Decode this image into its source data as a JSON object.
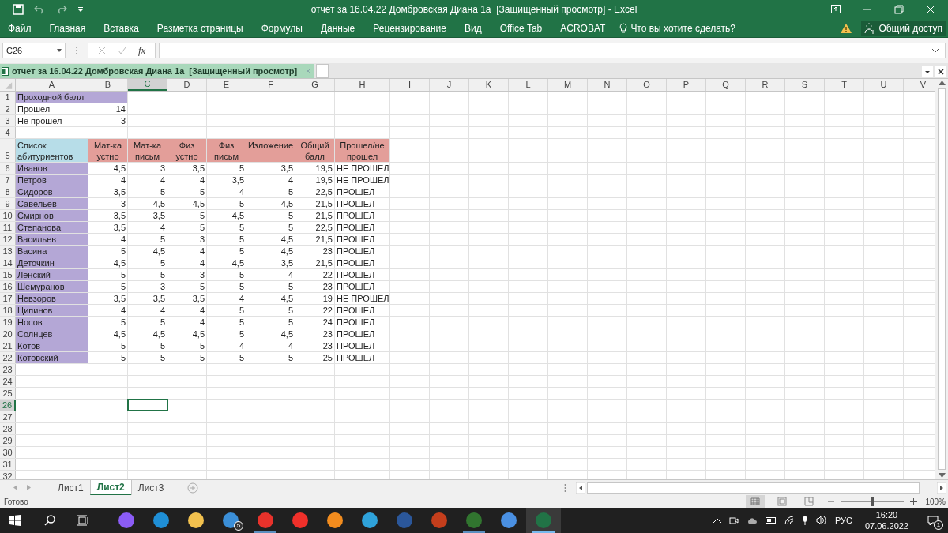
{
  "window": {
    "title": "отчет за 16.04.22 Домбровская Диана 1а  [Защищенный просмотр] - Excel"
  },
  "ribbon": {
    "tabs": [
      {
        "label": "Файл"
      },
      {
        "label": "Главная"
      },
      {
        "label": "Вставка"
      },
      {
        "label": "Разметка страницы"
      },
      {
        "label": "Формулы"
      },
      {
        "label": "Данные"
      },
      {
        "label": "Рецензирование"
      },
      {
        "label": "Вид"
      },
      {
        "label": "Office Tab"
      },
      {
        "label": "ACROBAT"
      }
    ],
    "tell_me": "Что вы хотите сделать?",
    "share": "Общий доступ"
  },
  "formula_bar": {
    "name_box": "C26",
    "function_label": "fx"
  },
  "document_tab": {
    "title": "отчет за 16.04.22 Домбровская Диана 1а  [Защищенный просмотр]"
  },
  "sheet": {
    "columns": [
      {
        "label": "A",
        "selected": false
      },
      {
        "label": "B",
        "selected": false
      },
      {
        "label": "C",
        "selected": true
      },
      {
        "label": "D",
        "selected": false
      },
      {
        "label": "E",
        "selected": false
      },
      {
        "label": "F",
        "selected": false
      },
      {
        "label": "G",
        "selected": false
      },
      {
        "label": "H",
        "selected": false
      },
      {
        "label": "I",
        "selected": false
      },
      {
        "label": "J",
        "selected": false
      },
      {
        "label": "K",
        "selected": false
      },
      {
        "label": "L",
        "selected": false
      },
      {
        "label": "M",
        "selected": false
      },
      {
        "label": "N",
        "selected": false
      },
      {
        "label": "O",
        "selected": false
      },
      {
        "label": "P",
        "selected": false
      },
      {
        "label": "Q",
        "selected": false
      },
      {
        "label": "R",
        "selected": false
      },
      {
        "label": "S",
        "selected": false
      },
      {
        "label": "T",
        "selected": false
      },
      {
        "label": "U",
        "selected": false
      },
      {
        "label": "V",
        "selected": false
      }
    ],
    "rows": [
      {
        "number": "1",
        "selected": false,
        "cells": [
          {
            "text": "Проходной балл",
            "kind": "name"
          },
          {
            "kind": "name"
          }
        ]
      },
      {
        "number": "2",
        "selected": false,
        "cells": [
          {
            "text": "Прошел",
            "kind": "label"
          },
          {
            "text": "14",
            "kind": "number"
          }
        ]
      },
      {
        "number": "3",
        "selected": false,
        "cells": [
          {
            "text": "Не прошел",
            "kind": "label"
          },
          {
            "text": "3",
            "kind": "number"
          }
        ]
      },
      {
        "number": "4",
        "selected": false
      },
      {
        "number": "5",
        "selected": false,
        "cells": [
          {
            "text": "Список абитуриентов",
            "kind": "list_head"
          },
          {
            "text": "Мат-ка устно",
            "kind": "col_head"
          },
          {
            "text": "Мат-ка письм",
            "kind": "col_head"
          },
          {
            "text": "Физ устно",
            "kind": "col_head"
          },
          {
            "text": "Физ письм",
            "kind": "col_head"
          },
          {
            "text": "Изложение",
            "kind": "col_head"
          },
          {
            "text": "Общий балл",
            "kind": "col_head"
          },
          {
            "text": "Прошел/не прошел",
            "kind": "col_head"
          }
        ]
      },
      {
        "number": "6",
        "selected": false,
        "cells": [
          {
            "text": "Иванов",
            "kind": "name"
          },
          {
            "text": "4,5",
            "kind": "number"
          },
          {
            "text": "3",
            "kind": "number"
          },
          {
            "text": "3,5",
            "kind": "number"
          },
          {
            "text": "5",
            "kind": "number"
          },
          {
            "text": "3,5",
            "kind": "number"
          },
          {
            "text": "19,5",
            "kind": "number"
          },
          {
            "text": "НЕ ПРОШЕЛ",
            "kind": "label"
          }
        ]
      },
      {
        "number": "7",
        "selected": false,
        "cells": [
          {
            "text": "Петров",
            "kind": "name"
          },
          {
            "text": "4",
            "kind": "number"
          },
          {
            "text": "4",
            "kind": "number"
          },
          {
            "text": "4",
            "kind": "number"
          },
          {
            "text": "3,5",
            "kind": "number"
          },
          {
            "text": "4",
            "kind": "number"
          },
          {
            "text": "19,5",
            "kind": "number"
          },
          {
            "text": "НЕ ПРОШЕЛ",
            "kind": "label"
          }
        ]
      },
      {
        "number": "8",
        "selected": false,
        "cells": [
          {
            "text": "Сидоров",
            "kind": "name"
          },
          {
            "text": "3,5",
            "kind": "number"
          },
          {
            "text": "5",
            "kind": "number"
          },
          {
            "text": "5",
            "kind": "number"
          },
          {
            "text": "4",
            "kind": "number"
          },
          {
            "text": "5",
            "kind": "number"
          },
          {
            "text": "22,5",
            "kind": "number"
          },
          {
            "text": "ПРОШЕЛ",
            "kind": "label"
          }
        ]
      },
      {
        "number": "9",
        "selected": false,
        "cells": [
          {
            "text": "Савельев",
            "kind": "name"
          },
          {
            "text": "3",
            "kind": "number"
          },
          {
            "text": "4,5",
            "kind": "number"
          },
          {
            "text": "4,5",
            "kind": "number"
          },
          {
            "text": "5",
            "kind": "number"
          },
          {
            "text": "4,5",
            "kind": "number"
          },
          {
            "text": "21,5",
            "kind": "number"
          },
          {
            "text": "ПРОШЕЛ",
            "kind": "label"
          }
        ]
      },
      {
        "number": "10",
        "selected": false,
        "cells": [
          {
            "text": "Смирнов",
            "kind": "name"
          },
          {
            "text": "3,5",
            "kind": "number"
          },
          {
            "text": "3,5",
            "kind": "number"
          },
          {
            "text": "5",
            "kind": "number"
          },
          {
            "text": "4,5",
            "kind": "number"
          },
          {
            "text": "5",
            "kind": "number"
          },
          {
            "text": "21,5",
            "kind": "number"
          },
          {
            "text": "ПРОШЕЛ",
            "kind": "label"
          }
        ]
      },
      {
        "number": "11",
        "selected": false,
        "cells": [
          {
            "text": "Степанова",
            "kind": "name"
          },
          {
            "text": "3,5",
            "kind": "number"
          },
          {
            "text": "4",
            "kind": "number"
          },
          {
            "text": "5",
            "kind": "number"
          },
          {
            "text": "5",
            "kind": "number"
          },
          {
            "text": "5",
            "kind": "number"
          },
          {
            "text": "22,5",
            "kind": "number"
          },
          {
            "text": "ПРОШЕЛ",
            "kind": "label"
          }
        ]
      },
      {
        "number": "12",
        "selected": false,
        "cells": [
          {
            "text": "Васильев",
            "kind": "name"
          },
          {
            "text": "4",
            "kind": "number"
          },
          {
            "text": "5",
            "kind": "number"
          },
          {
            "text": "3",
            "kind": "number"
          },
          {
            "text": "5",
            "kind": "number"
          },
          {
            "text": "4,5",
            "kind": "number"
          },
          {
            "text": "21,5",
            "kind": "number"
          },
          {
            "text": "ПРОШЕЛ",
            "kind": "label"
          }
        ]
      },
      {
        "number": "13",
        "selected": false,
        "cells": [
          {
            "text": "Васина",
            "kind": "name"
          },
          {
            "text": "5",
            "kind": "number"
          },
          {
            "text": "4,5",
            "kind": "number"
          },
          {
            "text": "4",
            "kind": "number"
          },
          {
            "text": "5",
            "kind": "number"
          },
          {
            "text": "4,5",
            "kind": "number"
          },
          {
            "text": "23",
            "kind": "number"
          },
          {
            "text": "ПРОШЕЛ",
            "kind": "label"
          }
        ]
      },
      {
        "number": "14",
        "selected": false,
        "cells": [
          {
            "text": "Деточкин",
            "kind": "name"
          },
          {
            "text": "4,5",
            "kind": "number"
          },
          {
            "text": "5",
            "kind": "number"
          },
          {
            "text": "4",
            "kind": "number"
          },
          {
            "text": "4,5",
            "kind": "number"
          },
          {
            "text": "3,5",
            "kind": "number"
          },
          {
            "text": "21,5",
            "kind": "number"
          },
          {
            "text": "ПРОШЕЛ",
            "kind": "label"
          }
        ]
      },
      {
        "number": "15",
        "selected": false,
        "cells": [
          {
            "text": "Ленский",
            "kind": "name"
          },
          {
            "text": "5",
            "kind": "number"
          },
          {
            "text": "5",
            "kind": "number"
          },
          {
            "text": "3",
            "kind": "number"
          },
          {
            "text": "5",
            "kind": "number"
          },
          {
            "text": "4",
            "kind": "number"
          },
          {
            "text": "22",
            "kind": "number"
          },
          {
            "text": "ПРОШЕЛ",
            "kind": "label"
          }
        ]
      },
      {
        "number": "16",
        "selected": false,
        "cells": [
          {
            "text": "Шемуранов",
            "kind": "name"
          },
          {
            "text": "5",
            "kind": "number"
          },
          {
            "text": "3",
            "kind": "number"
          },
          {
            "text": "5",
            "kind": "number"
          },
          {
            "text": "5",
            "kind": "number"
          },
          {
            "text": "5",
            "kind": "number"
          },
          {
            "text": "23",
            "kind": "number"
          },
          {
            "text": "ПРОШЕЛ",
            "kind": "label"
          }
        ]
      },
      {
        "number": "17",
        "selected": false,
        "cells": [
          {
            "text": "Невзоров",
            "kind": "name"
          },
          {
            "text": "3,5",
            "kind": "number"
          },
          {
            "text": "3,5",
            "kind": "number"
          },
          {
            "text": "3,5",
            "kind": "number"
          },
          {
            "text": "4",
            "kind": "number"
          },
          {
            "text": "4,5",
            "kind": "number"
          },
          {
            "text": "19",
            "kind": "number"
          },
          {
            "text": "НЕ ПРОШЕЛ",
            "kind": "label"
          }
        ]
      },
      {
        "number": "18",
        "selected": false,
        "cells": [
          {
            "text": "Ципинов",
            "kind": "name"
          },
          {
            "text": "4",
            "kind": "number"
          },
          {
            "text": "4",
            "kind": "number"
          },
          {
            "text": "4",
            "kind": "number"
          },
          {
            "text": "5",
            "kind": "number"
          },
          {
            "text": "5",
            "kind": "number"
          },
          {
            "text": "22",
            "kind": "number"
          },
          {
            "text": "ПРОШЕЛ",
            "kind": "label"
          }
        ]
      },
      {
        "number": "19",
        "selected": false,
        "cells": [
          {
            "text": "Носов",
            "kind": "name"
          },
          {
            "text": "5",
            "kind": "number"
          },
          {
            "text": "5",
            "kind": "number"
          },
          {
            "text": "4",
            "kind": "number"
          },
          {
            "text": "5",
            "kind": "number"
          },
          {
            "text": "5",
            "kind": "number"
          },
          {
            "text": "24",
            "kind": "number"
          },
          {
            "text": "ПРОШЕЛ",
            "kind": "label"
          }
        ]
      },
      {
        "number": "20",
        "selected": false,
        "cells": [
          {
            "text": "Солнцев",
            "kind": "name"
          },
          {
            "text": "4,5",
            "kind": "number"
          },
          {
            "text": "4,5",
            "kind": "number"
          },
          {
            "text": "4,5",
            "kind": "number"
          },
          {
            "text": "5",
            "kind": "number"
          },
          {
            "text": "4,5",
            "kind": "number"
          },
          {
            "text": "23",
            "kind": "number"
          },
          {
            "text": "ПРОШЕЛ",
            "kind": "label"
          }
        ]
      },
      {
        "number": "21",
        "selected": false,
        "cells": [
          {
            "text": "Котов",
            "kind": "name"
          },
          {
            "text": "5",
            "kind": "number"
          },
          {
            "text": "5",
            "kind": "number"
          },
          {
            "text": "5",
            "kind": "number"
          },
          {
            "text": "4",
            "kind": "number"
          },
          {
            "text": "4",
            "kind": "number"
          },
          {
            "text": "23",
            "kind": "number"
          },
          {
            "text": "ПРОШЕЛ",
            "kind": "label"
          }
        ]
      },
      {
        "number": "22",
        "selected": false,
        "cells": [
          {
            "text": "Котовский",
            "kind": "name"
          },
          {
            "text": "5",
            "kind": "number"
          },
          {
            "text": "5",
            "kind": "number"
          },
          {
            "text": "5",
            "kind": "number"
          },
          {
            "text": "5",
            "kind": "number"
          },
          {
            "text": "5",
            "kind": "number"
          },
          {
            "text": "25",
            "kind": "number"
          },
          {
            "text": "ПРОШЕЛ",
            "kind": "label"
          }
        ]
      },
      {
        "number": "23",
        "selected": false
      },
      {
        "number": "24",
        "selected": false
      },
      {
        "number": "25",
        "selected": false
      },
      {
        "number": "26",
        "selected": true
      },
      {
        "number": "27",
        "selected": false
      },
      {
        "number": "28",
        "selected": false
      },
      {
        "number": "29",
        "selected": false
      },
      {
        "number": "30",
        "selected": false
      },
      {
        "number": "31",
        "selected": false
      },
      {
        "number": "32",
        "selected": false
      }
    ]
  },
  "sheet_tabs": [
    {
      "label": "Лист1",
      "selected": false
    },
    {
      "label": "Лист2",
      "selected": true
    },
    {
      "label": "Лист3",
      "selected": false
    }
  ],
  "status_bar": {
    "text": "Готово",
    "zoom": "100%",
    "zoom_slider": {
      "level": 0.5
    }
  },
  "taskbar": {
    "apps": [
      {
        "color": "#8b5cf6",
        "running": false,
        "selected": false
      },
      {
        "color": "#1f8fd6",
        "running": false,
        "selected": false
      },
      {
        "color": "#f2c14e",
        "running": false,
        "selected": false
      },
      {
        "color": "#3b8fd8",
        "running": false,
        "selected": false,
        "badge": "5"
      },
      {
        "color": "#e8322b",
        "running": true,
        "selected": false
      },
      {
        "color": "#f0302a",
        "running": false,
        "selected": false
      },
      {
        "color": "#f28c1e",
        "running": false,
        "selected": false
      },
      {
        "color": "#2fa3db",
        "running": false,
        "selected": false
      },
      {
        "color": "#2b579a",
        "running": false,
        "selected": false
      },
      {
        "color": "#c43e1c",
        "running": false,
        "selected": false
      },
      {
        "color": "#31752f",
        "running": true,
        "selected": false
      },
      {
        "color": "#4a90e2",
        "running": false,
        "selected": false
      },
      {
        "color": "#217346",
        "running": true,
        "selected": true
      }
    ],
    "language": "РУС",
    "time": "16:20",
    "date": "07.06.2022",
    "notifications": "1"
  }
}
